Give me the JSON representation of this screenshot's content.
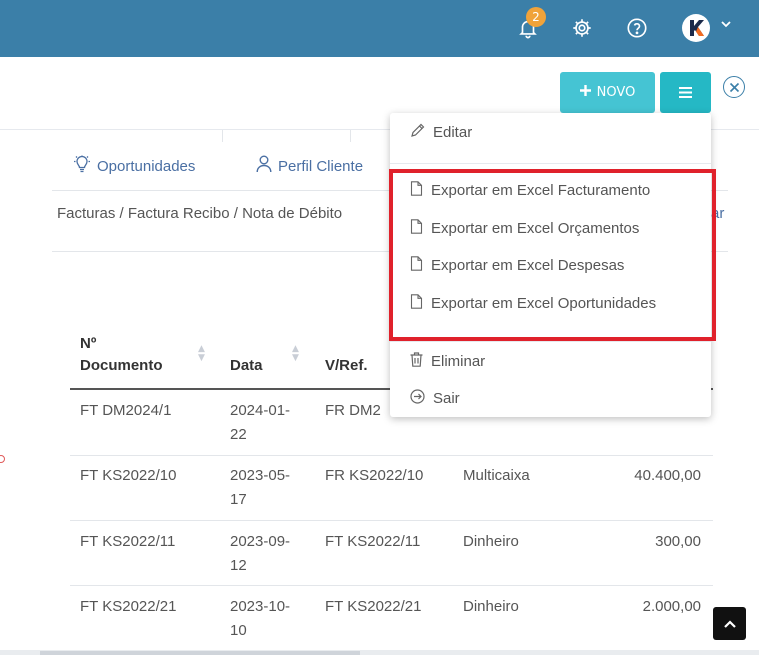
{
  "topbar": {
    "notification_count": "2",
    "avatar_letter": "K"
  },
  "toolbar": {
    "novo_label": "NOVO"
  },
  "tabs": [
    {
      "label": "Oportunidades",
      "icon": "lightbulb-icon"
    },
    {
      "label": "Perfil Cliente",
      "icon": "user-icon"
    }
  ],
  "breadcrumb": {
    "text": "Facturas / Factura Recibo / Nota de Débito",
    "tail": "ar"
  },
  "table": {
    "headers": [
      "Nº Documento",
      "Data",
      "V/Ref."
    ],
    "header_doc_line1": "Nº",
    "header_doc_line2": "Documento",
    "rows": [
      {
        "doc": "FT DM2024/1",
        "date_1": "2024-01-",
        "date_2": "22",
        "ref": "FR DM2",
        "payment": "",
        "amount": ""
      },
      {
        "doc": "FT KS2022/10",
        "date_1": "2023-05-",
        "date_2": "17",
        "ref": "FR KS2022/10",
        "payment": "Multicaixa",
        "amount": "40.400,00"
      },
      {
        "doc": "FT KS2022/11",
        "date_1": "2023-09-",
        "date_2": "12",
        "ref": "FT KS2022/11",
        "payment": "Dinheiro",
        "amount": "300,00"
      },
      {
        "doc": "FT KS2022/21",
        "date_1": "2023-10-",
        "date_2": "10",
        "ref": "FT KS2022/21",
        "payment": "Dinheiro",
        "amount": "2.000,00"
      }
    ]
  },
  "dropdown": {
    "edit": "Editar",
    "export_facturamento": "Exportar em Excel Facturamento",
    "export_orcamentos": "Exportar em Excel Orçamentos",
    "export_despesas": "Exportar em Excel Despesas",
    "export_oportunidades": "Exportar em Excel Oportunidades",
    "delete": "Eliminar",
    "exit": "Sair"
  },
  "colors": {
    "topbar": "#3b7fa8",
    "primary_button": "#45c4d3",
    "highlight_box": "#e0212b",
    "badge": "#f0a33a"
  }
}
